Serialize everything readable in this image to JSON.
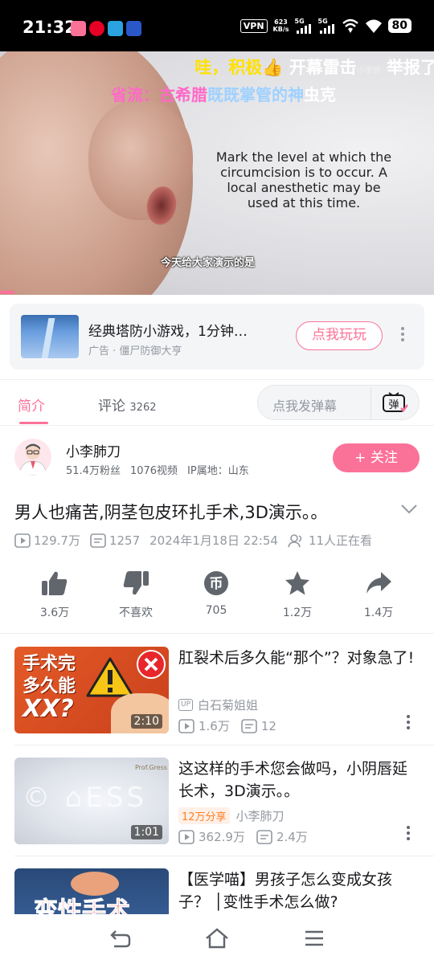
{
  "status_bar": {
    "time": "21:32",
    "vpn": "VPN",
    "net_speed_value": "623",
    "net_speed_unit": "KB/s",
    "signal1": "5G",
    "signal2": "5G",
    "battery": "80"
  },
  "video": {
    "danmaku_line1_a": "哇，积极",
    "danmaku_line1_b": "开幕雷击",
    "danmaku_line1_c": "举报了",
    "danmaku_watermark": "小李肺",
    "danmaku_line2_a": "省流：",
    "danmaku_line2_b": "古希腊",
    "danmaku_line2_c": "既既掌管的神",
    "danmaku_line2_d": "虫克",
    "caption_en": "Mark the level at which the circumcision is to occur. A local anesthetic may be used at this time.",
    "caption_cn": "今天给大家演示的是"
  },
  "ad": {
    "title": "经典塔防小游戏，1分钟…",
    "subtitle": "广告 · 僵尸防御大亨",
    "button": "点我玩玩"
  },
  "tabs": {
    "intro": "简介",
    "comments": "评论",
    "comments_count": "3262",
    "danmaku_placeholder": "点我发弹幕",
    "danmaku_icon_char": "弹"
  },
  "author": {
    "name": "小李肺刀",
    "fans": "51.4万粉丝",
    "videos": "1076视频",
    "ip": "IP属地：山东",
    "follow": "+ 关注"
  },
  "video_info": {
    "title": "男人也痛苦,阴茎包皮环扎手术,3D演示。。",
    "views": "129.7万",
    "danmaku": "1257",
    "date": "2024年1月18日 22:54",
    "watching": "11人正在看"
  },
  "actions": {
    "like": "3.6万",
    "dislike": "不喜欢",
    "coin": "705",
    "favorite": "1.2万",
    "share": "1.4万"
  },
  "related": [
    {
      "title": "肛裂术后多久能“那个”？对象急了!",
      "thumb_text1": "手术完",
      "thumb_text2": "多久能",
      "thumb_text3": "XX?",
      "duration": "2:10",
      "up": "白石菊姐姐",
      "up_badge": "UP",
      "views": "1.6万",
      "danmaku": "12"
    },
    {
      "title": "这这样的手术您会做吗，小阴唇延长术，3D演示。。",
      "thumb_brand": "Prof.Gress",
      "duration": "1:01",
      "share_badge": "12万分享",
      "up": "小李肺刀",
      "views": "362.9万",
      "danmaku": "2.4万"
    },
    {
      "title": "【医学喵】男孩子怎么变成女孩子？ │变性手术怎么做?",
      "thumb_text1": "变性手术"
    }
  ],
  "colors": {
    "accent": "#fb7299",
    "text_primary": "#18191c",
    "text_secondary": "#9499a0"
  }
}
